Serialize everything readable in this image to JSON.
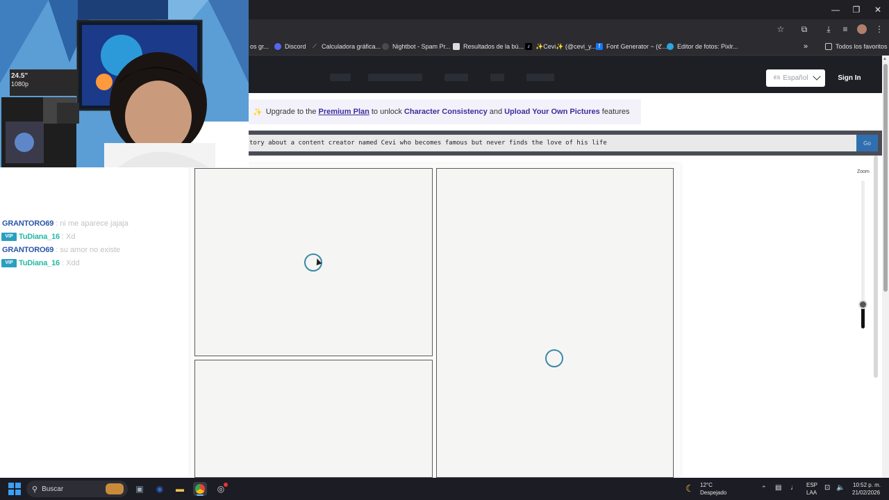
{
  "window_controls": {
    "minimize": "—",
    "restore": "❐",
    "close": "✕"
  },
  "bookmarks": [
    {
      "label": "os gr...",
      "icon": "blank-page-icon",
      "color": "#6b6b6b"
    },
    {
      "label": "Discord",
      "icon": "discord-icon",
      "color": "#5865f2"
    },
    {
      "label": "Calculadora gráfica...",
      "icon": "desmos-icon",
      "color": "#777777"
    },
    {
      "label": "Nightbot - Spam Pr...",
      "icon": "nightbot-icon",
      "color": "#4a4a4a"
    },
    {
      "label": "Resultados de la bú...",
      "icon": "document-icon",
      "color": "#dddddd"
    },
    {
      "label": "✨Cevi✨ (@cevi_y...",
      "icon": "tiktok-icon",
      "color": "#000000"
    },
    {
      "label": "Font Generator ~ (ℭ...",
      "icon": "facebook-icon",
      "color": "#1877f2"
    },
    {
      "label": "Editor de fotos: Pixlr...",
      "icon": "pixlr-icon",
      "color": "#2aa6e0"
    }
  ],
  "bookmarks_overflow": "»",
  "all_favorites": "Todos los favoritos",
  "header": {
    "language_flag": "ES",
    "language": "Español",
    "sign_in": "Sign In"
  },
  "banner": {
    "prefix": "Upgrade to the",
    "plan_link": "Premium Plan",
    "middle": "to unlock",
    "feature1": "Character Consistency",
    "and": "and",
    "feature2": "Upload Your Own Pictures",
    "suffix": "features"
  },
  "prompt": {
    "value": "tory about a content creator named Cevi who becomes famous but never finds the love of his life",
    "go_label": "Go"
  },
  "zoom": {
    "label": "Zoom",
    "level": 0.15
  },
  "chat": [
    {
      "user": "GRANTORO69",
      "sep": ":",
      "message": "ni me aparece jajaja",
      "badge": ""
    },
    {
      "user": "TuDiana_16",
      "sep": ":",
      "message": "Xd",
      "badge": "VIP"
    },
    {
      "user": "GRANTORO69",
      "sep": ":",
      "message": "su amor no existe",
      "badge": ""
    },
    {
      "user": "TuDiana_16",
      "sep": ":",
      "message": "Xdd",
      "badge": "VIP"
    }
  ],
  "webcam": {
    "monitor_label_1": "24.5\"",
    "monitor_label_2": "1080p"
  },
  "taskbar": {
    "search_placeholder": "Buscar",
    "weather_temp": "12°C",
    "weather_desc": "Despejado",
    "lang_top": "ESP",
    "lang_bottom": "LAA",
    "time": "10:52 p. m.",
    "date": "21/02/2026"
  },
  "colors": {
    "accent_link": "#3b2f9a",
    "go_button": "#2f6fb0",
    "spinner": "#3a89a8",
    "chat_user_1": "#2a55a8",
    "chat_user_2": "#23b9a4"
  }
}
